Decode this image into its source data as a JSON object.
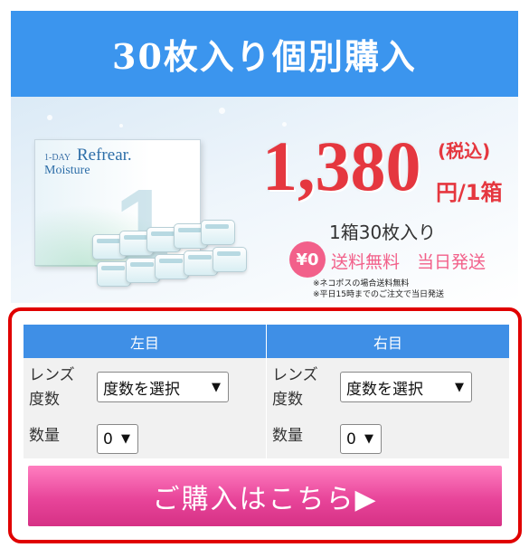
{
  "header": {
    "title": "30枚入り個別購入"
  },
  "product": {
    "brand_small": "1-DAY",
    "brand": "Refrear.",
    "sub": "Moisture",
    "box_number": "1"
  },
  "price": {
    "amount": "1,380",
    "tax": "(税込)",
    "unit": "円/1箱",
    "quantity_text": "1箱30枚入り",
    "yen_badge": "¥0",
    "shipping": "送料無料　当日発送",
    "note1": "※ネコポスの場合送料無料",
    "note2": "※平日15時までのご注文で当日発送"
  },
  "order": {
    "left_eye": {
      "header": "左目",
      "power_label": "レンズ\n度数",
      "power_value": "度数を選択",
      "qty_label": "数量",
      "qty_value": "0"
    },
    "right_eye": {
      "header": "右目",
      "power_label": "レンズ\n度数",
      "power_value": "度数を選択",
      "qty_label": "数量",
      "qty_value": "0"
    },
    "buy_label": "ご購入はこちら▶"
  },
  "colors": {
    "header_bg": "#3b95ee",
    "price_red": "#e5373f",
    "pink": "#f2608a",
    "panel_border": "#e00000"
  }
}
